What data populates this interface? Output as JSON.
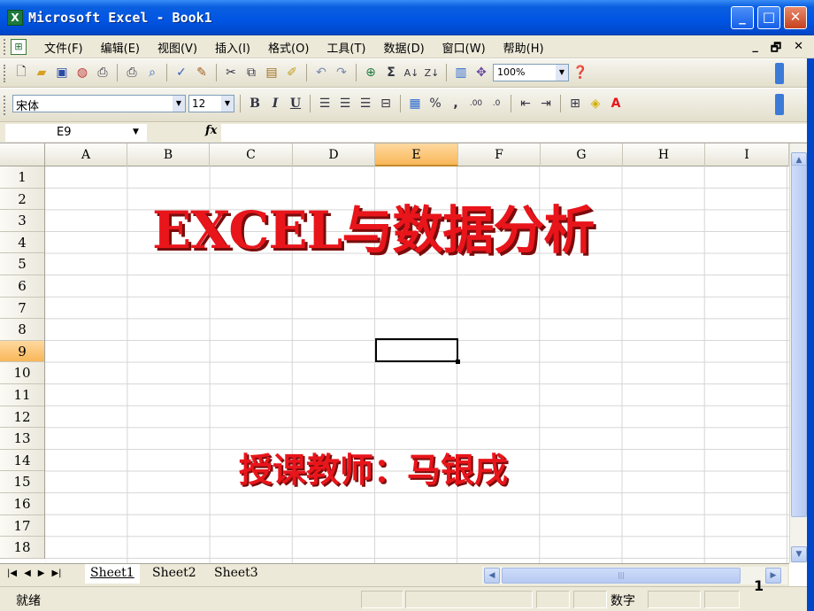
{
  "window": {
    "title": "Microsoft Excel - Book1",
    "minimize_label": "_",
    "maximize_label": "□",
    "close_label": "✕"
  },
  "menu": {
    "items": [
      "文件(F)",
      "编辑(E)",
      "视图(V)",
      "插入(I)",
      "格式(O)",
      "工具(T)",
      "数据(D)",
      "窗口(W)",
      "帮助(H)"
    ],
    "doc_controls": [
      "_",
      "🗗",
      "✕"
    ]
  },
  "toolbar": {
    "zoom": "100%"
  },
  "format_bar": {
    "font_name": "宋体",
    "font_size": "12",
    "bold": "B",
    "italic": "I",
    "underline": "U",
    "percent": "%",
    "comma": ","
  },
  "formula_bar": {
    "name_box": "E9",
    "fx": "fx",
    "value": ""
  },
  "grid": {
    "columns": [
      "A",
      "B",
      "C",
      "D",
      "E",
      "F",
      "G",
      "H",
      "I"
    ],
    "rows": [
      "1",
      "2",
      "3",
      "4",
      "5",
      "6",
      "7",
      "8",
      "9",
      "10",
      "11",
      "12",
      "13",
      "14",
      "15",
      "16",
      "17",
      "18"
    ],
    "active_cell": "E9"
  },
  "content": {
    "title": "EXCEL与数据分析",
    "teacher": "授课教师：马银戌"
  },
  "sheets": {
    "tabs": [
      "Sheet1",
      "Sheet2",
      "Sheet3"
    ],
    "active": "Sheet1"
  },
  "status": {
    "ready": "就绪",
    "num": "数字",
    "page_number": "1"
  },
  "colors": {
    "title_red": "#e8151b",
    "titlebar_blue": "#0054e3",
    "active_header": "#f8b758"
  }
}
